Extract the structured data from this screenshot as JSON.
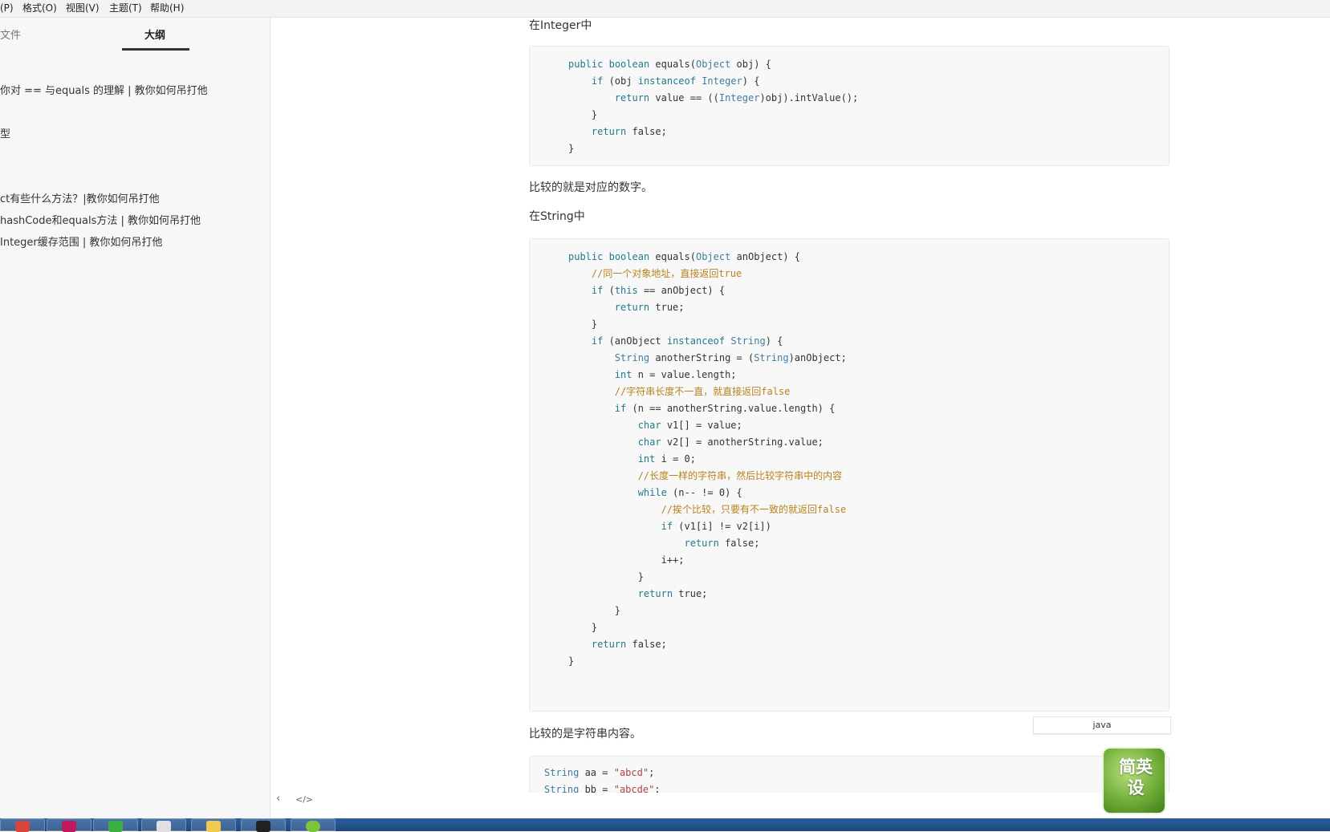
{
  "menubar": {
    "items": [
      "(P)",
      "格式(O)",
      "视图(V)",
      "主题(T)",
      "帮助(H)"
    ]
  },
  "sidebar": {
    "tab_files": "文件",
    "tab_outline": "大纲",
    "outline_items": [
      "你对 == 与equals 的理解 | 教你如何吊打他",
      "型",
      "ct有些什么方法？|教你如何吊打他",
      "hashCode和equals方法 | 教你如何吊打他",
      "Integer缓存范围 | 教你如何吊打他"
    ],
    "footer_back": "‹",
    "footer_source": "</>"
  },
  "content": {
    "heading_integer": "在Integer中",
    "integer_code": [
      "public boolean equals(Object obj) {",
      "    if (obj instanceof Integer) {",
      "        return value == ((Integer)obj).intValue();",
      "    }",
      "    return false;",
      "}"
    ],
    "para_compare_number": "比较的就是对应的数字。",
    "heading_string": "在String中",
    "string_code": [
      "public boolean equals(Object anObject) {",
      "    //同一个对象地址，直接返回true",
      "    if (this == anObject) {",
      "        return true;",
      "    }",
      "    if (anObject instanceof String) {",
      "        String anotherString = (String)anObject;",
      "        int n = value.length;",
      "        //字符串长度不一直，就直接返回false",
      "        if (n == anotherString.value.length) {",
      "            char v1[] = value;",
      "            char v2[] = anotherString.value;",
      "            int i = 0;",
      "            //长度一样的字符串，然后比较字符串中的内容",
      "            while (n-- != 0) {",
      "                //挨个比较，只要有不一致的就返回false",
      "                if (v1[i] != v2[i])",
      "                    return false;",
      "                i++;",
      "            }",
      "            return true;",
      "        }",
      "    }",
      "    return false;",
      "}"
    ],
    "lang_label": "java",
    "para_compare_content": "比较的是字符串内容。",
    "snippet_code": [
      "String aa = \"abcd\";",
      "String bb = \"abcde\";"
    ],
    "logo_text": "简英设"
  },
  "colors": {
    "keyword": "#1f7a8c",
    "comment": "#b7831d",
    "taskbar": "#2b5f9e"
  },
  "taskbar": {
    "icons": [
      "chrome-icon",
      "intellij-icon",
      "wechat-icon",
      "typora-icon",
      "notepad-icon",
      "terminal-icon",
      "app-icon"
    ]
  }
}
